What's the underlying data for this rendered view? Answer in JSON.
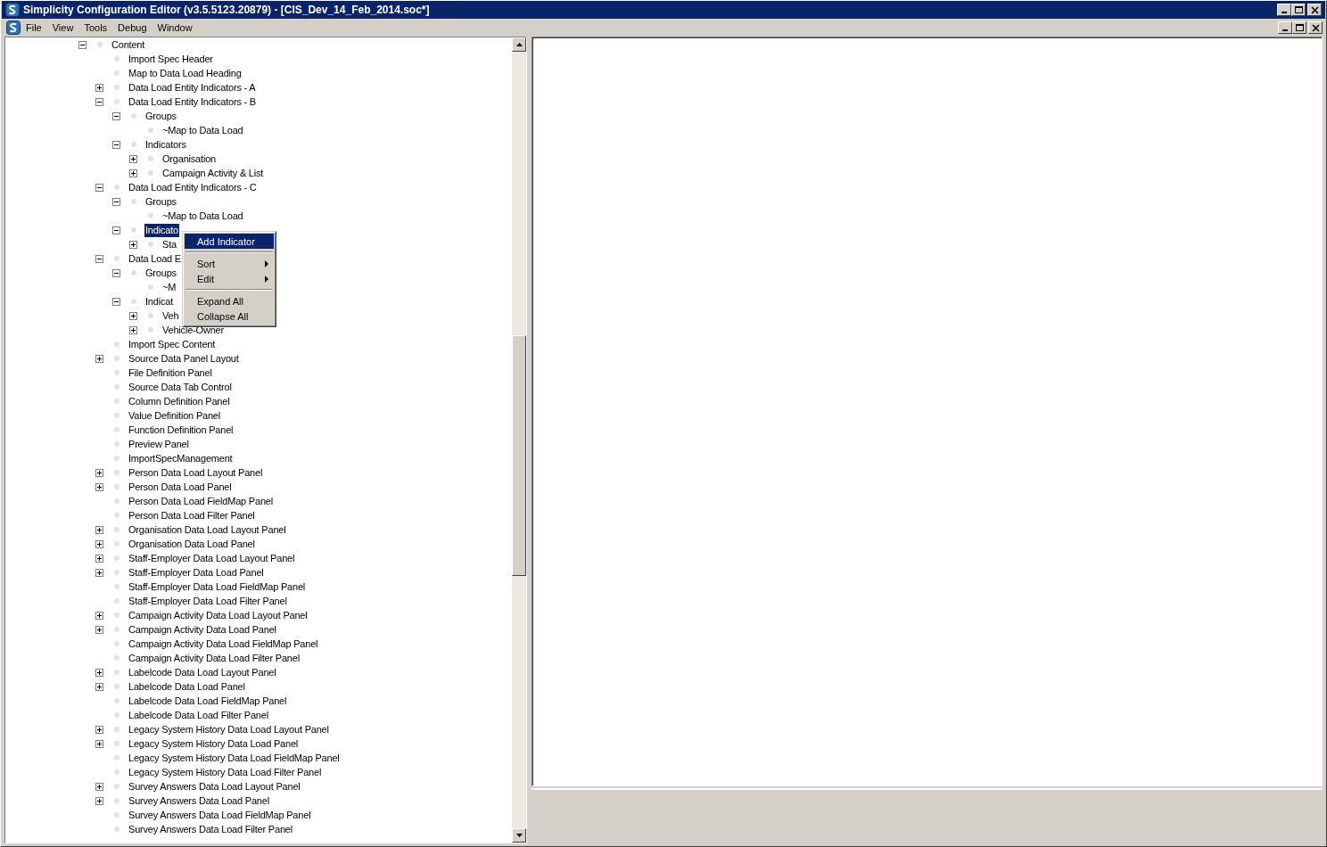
{
  "window": {
    "title": "Simplicity Configuration Editor (v3.5.5123.20879) - [CIS_Dev_14_Feb_2014.soc*]"
  },
  "menu_bar": [
    "File",
    "View",
    "Tools",
    "Debug",
    "Window"
  ],
  "tree": [
    {
      "label": "Content",
      "kind": "node",
      "expanded": true,
      "selected": false,
      "children": [
        {
          "label": "Import Spec Header",
          "kind": "leaf",
          "selected": false
        },
        {
          "label": "Map to Data Load Heading",
          "kind": "leaf",
          "selected": false
        },
        {
          "label": "Data Load Entity Indicators - A",
          "kind": "node",
          "expanded": false,
          "selected": false
        },
        {
          "label": "Data Load Entity Indicators - B",
          "kind": "node",
          "expanded": true,
          "selected": false,
          "children": [
            {
              "label": "Groups",
              "kind": "node",
              "expanded": true,
              "selected": false,
              "children": [
                {
                  "label": "~Map to Data Load",
                  "kind": "leaf",
                  "selected": false
                }
              ]
            },
            {
              "label": "Indicators",
              "kind": "node",
              "expanded": true,
              "selected": false,
              "children": [
                {
                  "label": "Organisation",
                  "kind": "node",
                  "expanded": false,
                  "selected": false
                },
                {
                  "label": "Campaign Activity & List",
                  "kind": "node",
                  "expanded": false,
                  "selected": false
                }
              ]
            }
          ]
        },
        {
          "label": "Data Load Entity Indicators - C",
          "kind": "node",
          "expanded": true,
          "selected": false,
          "children": [
            {
              "label": "Groups",
              "kind": "node",
              "expanded": true,
              "selected": false,
              "children": [
                {
                  "label": "~Map to Data Load",
                  "kind": "leaf",
                  "selected": false
                }
              ]
            },
            {
              "label": "Indicato",
              "kind": "node",
              "expanded": true,
              "selected": true,
              "children": [
                {
                  "label": "Sta",
                  "kind": "node",
                  "expanded": false,
                  "selected": false
                }
              ]
            }
          ]
        },
        {
          "label": "Data Load E",
          "kind": "node",
          "expanded": true,
          "selected": false,
          "children": [
            {
              "label": "Groups",
              "kind": "node",
              "expanded": true,
              "selected": false,
              "children": [
                {
                  "label": "~M",
                  "kind": "leaf",
                  "selected": false
                }
              ]
            },
            {
              "label": "Indicat",
              "kind": "node",
              "expanded": true,
              "selected": false,
              "children": [
                {
                  "label": "Veh",
                  "kind": "node",
                  "expanded": false,
                  "selected": false
                },
                {
                  "label": "Vehicle-Owner",
                  "kind": "node",
                  "expanded": false,
                  "selected": false
                }
              ]
            }
          ]
        },
        {
          "label": "Import Spec Content",
          "kind": "leaf",
          "selected": false
        },
        {
          "label": "Source Data Panel Layout",
          "kind": "node",
          "expanded": false,
          "selected": false
        },
        {
          "label": "File Definition Panel",
          "kind": "leaf",
          "selected": false
        },
        {
          "label": "Source Data Tab Control",
          "kind": "leaf",
          "selected": false
        },
        {
          "label": "Column Definition Panel",
          "kind": "leaf",
          "selected": false
        },
        {
          "label": "Value Definition Panel",
          "kind": "leaf",
          "selected": false
        },
        {
          "label": "Function Definition Panel",
          "kind": "leaf",
          "selected": false
        },
        {
          "label": "Preview Panel",
          "kind": "leaf",
          "selected": false
        },
        {
          "label": "ImportSpecManagement",
          "kind": "leaf",
          "selected": false
        },
        {
          "label": "Person Data Load Layout Panel",
          "kind": "node",
          "expanded": false,
          "selected": false
        },
        {
          "label": "Person Data Load Panel",
          "kind": "node",
          "expanded": false,
          "selected": false
        },
        {
          "label": "Person Data Load FieldMap Panel",
          "kind": "leaf",
          "selected": false
        },
        {
          "label": "Person Data Load Filter Panel",
          "kind": "leaf",
          "selected": false
        },
        {
          "label": "Organisation Data Load Layout Panel",
          "kind": "node",
          "expanded": false,
          "selected": false
        },
        {
          "label": "Organisation Data Load Panel",
          "kind": "node",
          "expanded": false,
          "selected": false
        },
        {
          "label": "Staff-Employer Data Load Layout Panel",
          "kind": "node",
          "expanded": false,
          "selected": false
        },
        {
          "label": "Staff-Employer Data Load Panel",
          "kind": "node",
          "expanded": false,
          "selected": false
        },
        {
          "label": "Staff-Employer Data Load FieldMap Panel",
          "kind": "leaf",
          "selected": false
        },
        {
          "label": "Staff-Employer Data Load Filter Panel",
          "kind": "leaf",
          "selected": false
        },
        {
          "label": "Campaign Activity Data Load Layout Panel",
          "kind": "node",
          "expanded": false,
          "selected": false
        },
        {
          "label": "Campaign Activity Data Load Panel",
          "kind": "node",
          "expanded": false,
          "selected": false
        },
        {
          "label": "Campaign Activity Data Load FieldMap Panel",
          "kind": "leaf",
          "selected": false
        },
        {
          "label": "Campaign Activity Data Load Filter Panel",
          "kind": "leaf",
          "selected": false
        },
        {
          "label": "Labelcode Data Load Layout Panel",
          "kind": "node",
          "expanded": false,
          "selected": false
        },
        {
          "label": "Labelcode Data Load Panel",
          "kind": "node",
          "expanded": false,
          "selected": false
        },
        {
          "label": "Labelcode Data Load FieldMap Panel",
          "kind": "leaf",
          "selected": false
        },
        {
          "label": "Labelcode Data Load Filter Panel",
          "kind": "leaf",
          "selected": false
        },
        {
          "label": "Legacy System History Data Load Layout Panel",
          "kind": "node",
          "expanded": false,
          "selected": false
        },
        {
          "label": "Legacy System History Data Load Panel",
          "kind": "node",
          "expanded": false,
          "selected": false
        },
        {
          "label": "Legacy System History Data Load FieldMap Panel",
          "kind": "leaf",
          "selected": false
        },
        {
          "label": "Legacy System History Data Load Filter Panel",
          "kind": "leaf",
          "selected": false
        },
        {
          "label": "Survey Answers Data Load Layout Panel",
          "kind": "node",
          "expanded": false,
          "selected": false
        },
        {
          "label": "Survey Answers Data Load Panel",
          "kind": "node",
          "expanded": false,
          "selected": false
        },
        {
          "label": "Survey Answers Data Load FieldMap Panel",
          "kind": "leaf",
          "selected": false
        },
        {
          "label": "Survey Answers Data Load Filter Panel",
          "kind": "leaf",
          "selected": false
        }
      ]
    }
  ],
  "context_menu": [
    {
      "kind": "item",
      "label": "Add Indicator",
      "selected": true
    },
    {
      "kind": "separator"
    },
    {
      "kind": "submenu",
      "label": "Sort",
      "selected": false
    },
    {
      "kind": "submenu",
      "label": "Edit",
      "selected": false
    },
    {
      "kind": "separator"
    },
    {
      "kind": "item",
      "label": "Expand All",
      "selected": false
    },
    {
      "kind": "item",
      "label": "Collapse All",
      "selected": false
    }
  ]
}
